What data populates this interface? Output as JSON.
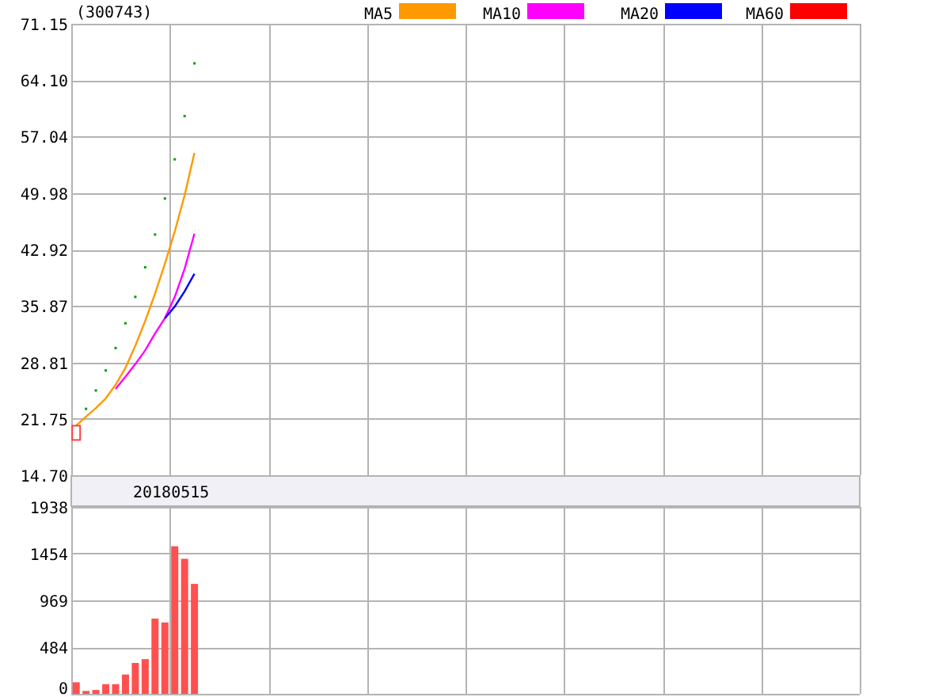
{
  "title": "(300743)",
  "price_chart": {
    "chart_data": {
      "type": "line",
      "grid": true,
      "categories": [
        null,
        null,
        null,
        null,
        null,
        null,
        null,
        null,
        null,
        null,
        null,
        null,
        null,
        null,
        null,
        null,
        null,
        null,
        null,
        null,
        null,
        null,
        null,
        null,
        null,
        null,
        null,
        null,
        null,
        null,
        null,
        null,
        null,
        null,
        null,
        null,
        null,
        null,
        null,
        null,
        null,
        null,
        null,
        null,
        null,
        null,
        null,
        null,
        null,
        null,
        null,
        null,
        null,
        null,
        null,
        null,
        null,
        null,
        null,
        null,
        null,
        null,
        null,
        null,
        null,
        null,
        null,
        null,
        null,
        null,
        null,
        null,
        null,
        null,
        null,
        null,
        null,
        null,
        null,
        null
      ],
      "ylim": [
        14.7,
        71.15
      ],
      "yticks": [
        {
          "value": 71.15,
          "label": "71.15"
        },
        {
          "value": 64.1,
          "label": "64.10"
        },
        {
          "value": 57.04,
          "label": "57.04"
        },
        {
          "value": 49.98,
          "label": "49.98"
        },
        {
          "value": 42.92,
          "label": "42.92"
        },
        {
          "value": 35.87,
          "label": "35.87"
        },
        {
          "value": 28.81,
          "label": "28.81"
        },
        {
          "value": 21.75,
          "label": "21.75"
        },
        {
          "value": 14.7,
          "label": "14.70"
        }
      ],
      "series": [
        {
          "name": "MA5",
          "color": "#ff9900",
          "values": [
            20.9,
            22.0,
            23.1,
            24.3,
            26.0,
            28.1,
            30.9,
            34.0,
            37.4,
            41.1,
            45.2,
            49.7,
            55.0,
            null,
            null,
            null,
            null,
            null,
            null,
            null,
            null,
            null,
            null,
            null,
            null,
            null,
            null,
            null,
            null,
            null,
            null,
            null,
            null,
            null,
            null,
            null,
            null,
            null,
            null,
            null,
            null,
            null,
            null,
            null,
            null,
            null,
            null,
            null,
            null,
            null,
            null,
            null,
            null,
            null,
            null,
            null,
            null,
            null,
            null,
            null,
            null,
            null,
            null,
            null,
            null,
            null,
            null,
            null,
            null,
            null,
            null,
            null,
            null,
            null,
            null,
            null,
            null,
            null,
            null,
            null
          ]
        },
        {
          "name": "MA10",
          "color": "#ff00ff",
          "values": [
            null,
            null,
            null,
            null,
            25.5,
            27.0,
            28.6,
            30.3,
            32.4,
            34.3,
            37.0,
            40.5,
            44.9,
            null,
            null,
            null,
            null,
            null,
            null,
            null,
            null,
            null,
            null,
            null,
            null,
            null,
            null,
            null,
            null,
            null,
            null,
            null,
            null,
            null,
            null,
            null,
            null,
            null,
            null,
            null,
            null,
            null,
            null,
            null,
            null,
            null,
            null,
            null,
            null,
            null,
            null,
            null,
            null,
            null,
            null,
            null,
            null,
            null,
            null,
            null,
            null,
            null,
            null,
            null,
            null,
            null,
            null,
            null,
            null,
            null,
            null,
            null,
            null,
            null,
            null,
            null,
            null,
            null,
            null,
            null
          ]
        },
        {
          "name": "MA20",
          "color": "#0000ff",
          "values": [
            null,
            null,
            null,
            null,
            null,
            null,
            null,
            null,
            null,
            34.3,
            35.8,
            37.7,
            39.9,
            null,
            null,
            null,
            null,
            null,
            null,
            null,
            null,
            null,
            null,
            null,
            null,
            null,
            null,
            null,
            null,
            null,
            null,
            null,
            null,
            null,
            null,
            null,
            null,
            null,
            null,
            null,
            null,
            null,
            null,
            null,
            null,
            null,
            null,
            null,
            null,
            null,
            null,
            null,
            null,
            null,
            null,
            null,
            null,
            null,
            null,
            null,
            null,
            null,
            null,
            null,
            null,
            null,
            null,
            null,
            null,
            null,
            null,
            null,
            null,
            null,
            null,
            null,
            null,
            null,
            null,
            null
          ]
        },
        {
          "name": "MA60",
          "color": "#ff0000",
          "values": [
            null,
            null,
            null,
            null,
            null,
            null,
            null,
            null,
            null,
            null,
            null,
            null,
            null,
            null,
            null,
            null,
            null,
            null,
            null,
            null,
            null,
            null,
            null,
            null,
            null,
            null,
            null,
            null,
            null,
            null,
            null,
            null,
            null,
            null,
            null,
            null,
            null,
            null,
            null,
            null,
            null,
            null,
            null,
            null,
            null,
            null,
            null,
            null,
            null,
            null,
            null,
            null,
            null,
            null,
            null,
            null,
            null,
            null,
            null,
            null,
            null,
            null,
            null,
            null,
            null,
            null,
            null,
            null,
            null,
            null,
            null,
            null,
            null,
            null,
            null,
            null,
            null,
            null,
            null,
            null
          ]
        },
        {
          "type": "scatter",
          "color": "#ff4040",
          "values": [
            20.0,
            null,
            null,
            null,
            null,
            null,
            null,
            null,
            null,
            null,
            null,
            null,
            null,
            null,
            null,
            null,
            null,
            null,
            null,
            null,
            null,
            null,
            null,
            null,
            null,
            null,
            null,
            null,
            null,
            null,
            null,
            null,
            null,
            null,
            null,
            null,
            null,
            null,
            null,
            null,
            null,
            null,
            null,
            null,
            null,
            null,
            null,
            null,
            null,
            null,
            null,
            null,
            null,
            null,
            null,
            null,
            null,
            null,
            null,
            null,
            null,
            null,
            null,
            null,
            null,
            null,
            null,
            null,
            null,
            null,
            null,
            null,
            null,
            null,
            null,
            null,
            null,
            null,
            null,
            null
          ]
        },
        {
          "type": "scatter",
          "color": "#00a000",
          "values": [
            null,
            23.0,
            25.3,
            27.8,
            30.6,
            33.7,
            37.0,
            40.7,
            44.8,
            49.3,
            54.2,
            59.6,
            66.2,
            null,
            null,
            null,
            null,
            null,
            null,
            null,
            null,
            null,
            null,
            null,
            null,
            null,
            null,
            null,
            null,
            null,
            null,
            null,
            null,
            null,
            null,
            null,
            null,
            null,
            null,
            null,
            null,
            null,
            null,
            null,
            null,
            null,
            null,
            null,
            null,
            null,
            null,
            null,
            null,
            null,
            null,
            null,
            null,
            null,
            null,
            null,
            null,
            null,
            null,
            null,
            null,
            null,
            null,
            null,
            null,
            null,
            null,
            null,
            null,
            null,
            null,
            null,
            null,
            null,
            null,
            null
          ]
        }
      ]
    }
  },
  "date_label": "20180515",
  "volume_chart": {
    "chart_data": {
      "type": "bar",
      "grid": true,
      "categories": [
        null,
        null,
        null,
        null,
        null,
        null,
        null,
        null,
        null,
        null,
        null,
        null,
        null,
        null,
        null,
        null,
        null,
        null,
        null,
        null,
        null,
        null,
        null,
        null,
        null,
        null,
        null,
        null,
        null,
        null,
        null,
        null,
        null,
        null,
        null,
        null,
        null,
        null,
        null,
        null,
        null,
        null,
        null,
        null,
        null,
        null,
        null,
        null,
        null,
        null,
        null,
        null,
        null,
        null,
        null,
        null,
        null,
        null,
        null,
        null,
        null,
        null,
        null,
        null,
        null,
        null,
        null,
        null,
        null,
        null,
        null,
        null,
        null,
        null,
        null,
        null,
        null,
        null,
        null,
        null
      ],
      "ylim": [
        0,
        1938
      ],
      "yticks": [
        {
          "value": 1938,
          "label": "1938"
        },
        {
          "value": 1454,
          "label": "1454"
        },
        {
          "value": 969,
          "label": "969"
        },
        {
          "value": 484,
          "label": "484"
        },
        {
          "value": 0,
          "label": "0"
        }
      ],
      "values": [
        120,
        30,
        40,
        100,
        100,
        200,
        320,
        360,
        780,
        740,
        1530,
        1400,
        1140,
        null,
        null,
        null,
        null,
        null,
        null,
        null,
        null,
        null,
        null,
        null,
        null,
        null,
        null,
        null,
        null,
        null,
        null,
        null,
        null,
        null,
        null,
        null,
        null,
        null,
        null,
        null,
        null,
        null,
        null,
        null,
        null,
        null,
        null,
        null,
        null,
        null,
        null,
        null,
        null,
        null,
        null,
        null,
        null,
        null,
        null,
        null,
        null,
        null,
        null,
        null,
        null,
        null,
        null,
        null,
        null,
        null,
        null,
        null,
        null,
        null,
        null,
        null,
        null,
        null,
        null,
        null
      ]
    }
  }
}
